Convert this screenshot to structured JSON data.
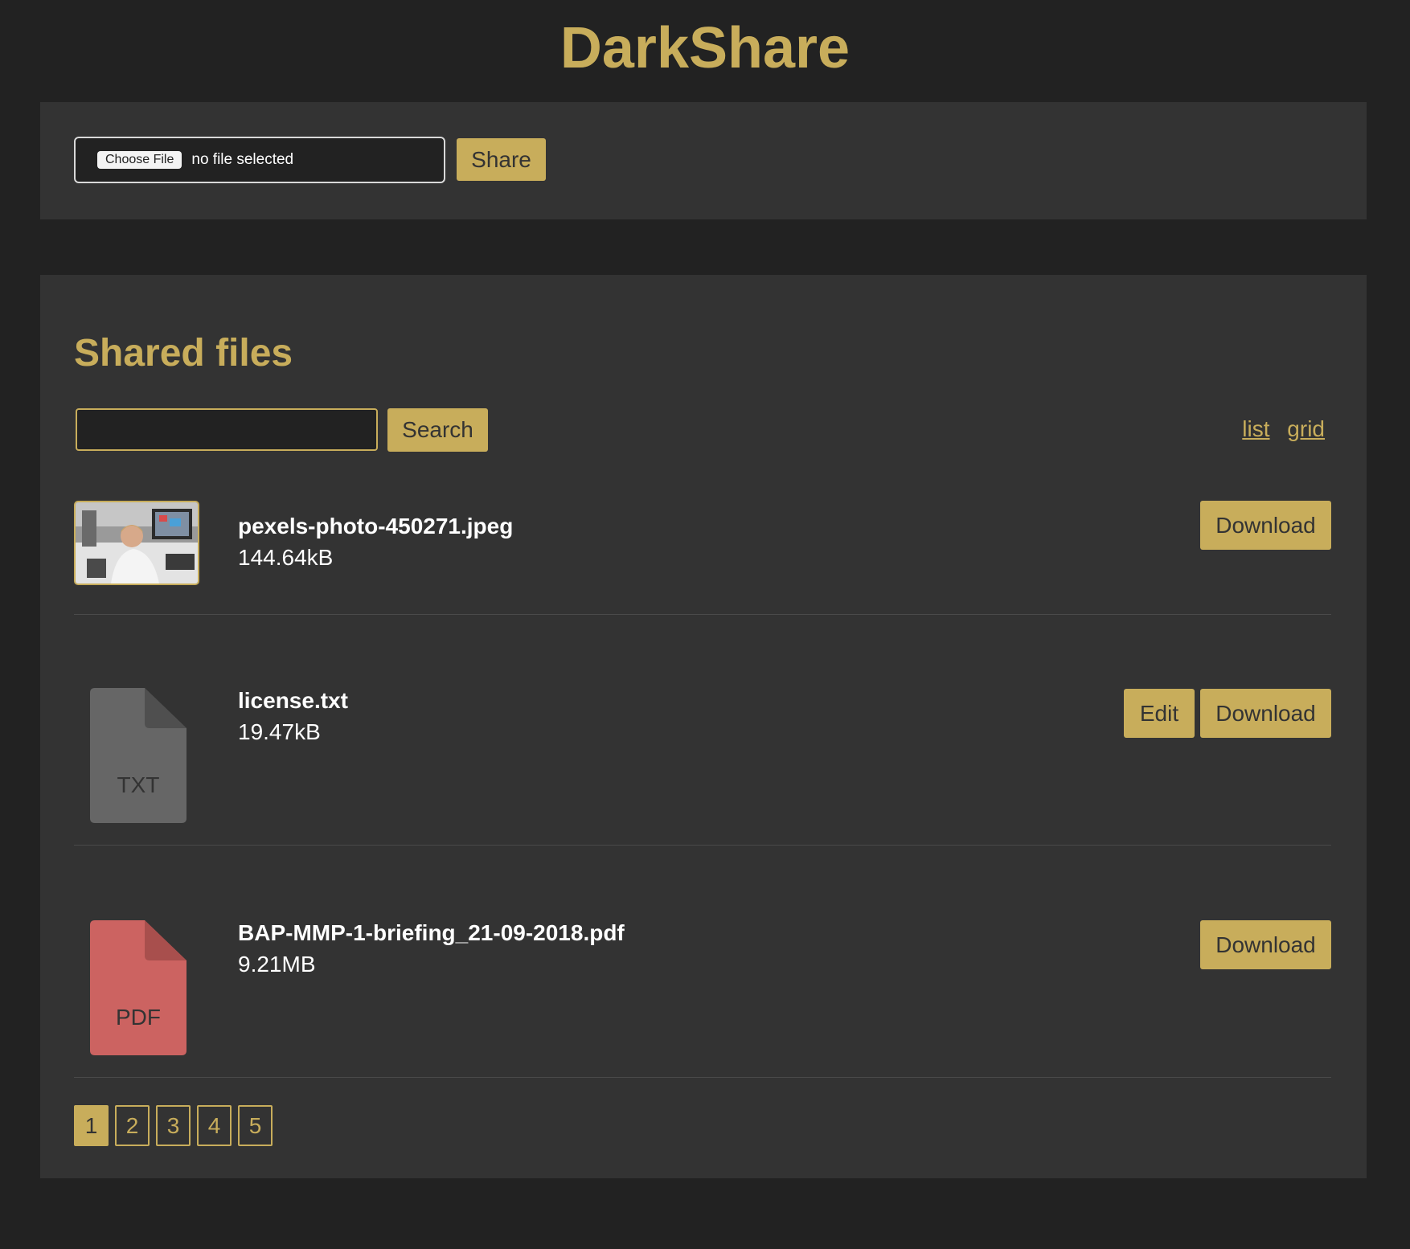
{
  "app": {
    "title": "DarkShare"
  },
  "upload": {
    "choose_file_label": "Choose File",
    "file_status": "no file selected",
    "share_label": "Share"
  },
  "shared_files": {
    "title": "Shared files",
    "search": {
      "value": "",
      "button_label": "Search"
    },
    "view_toggle": {
      "list_label": "list",
      "grid_label": "grid"
    },
    "files": [
      {
        "name": "pexels-photo-450271.jpeg",
        "size": "144.64kB",
        "thumbnail": "photo",
        "download_label": "Download"
      },
      {
        "name": "license.txt",
        "size": "19.47kB",
        "icon_label": "TXT",
        "icon_color": "#666666",
        "edit_label": "Edit",
        "download_label": "Download"
      },
      {
        "name": "BAP-MMP-1-briefing_21-09-2018.pdf",
        "size": "9.21MB",
        "icon_label": "PDF",
        "icon_color": "#cc6361",
        "download_label": "Download"
      }
    ],
    "pagination": {
      "pages": [
        "1",
        "2",
        "3",
        "4",
        "5"
      ],
      "current": "1"
    }
  },
  "colors": {
    "accent": "#c8ad5b",
    "background": "#222222",
    "panel": "#333333"
  }
}
